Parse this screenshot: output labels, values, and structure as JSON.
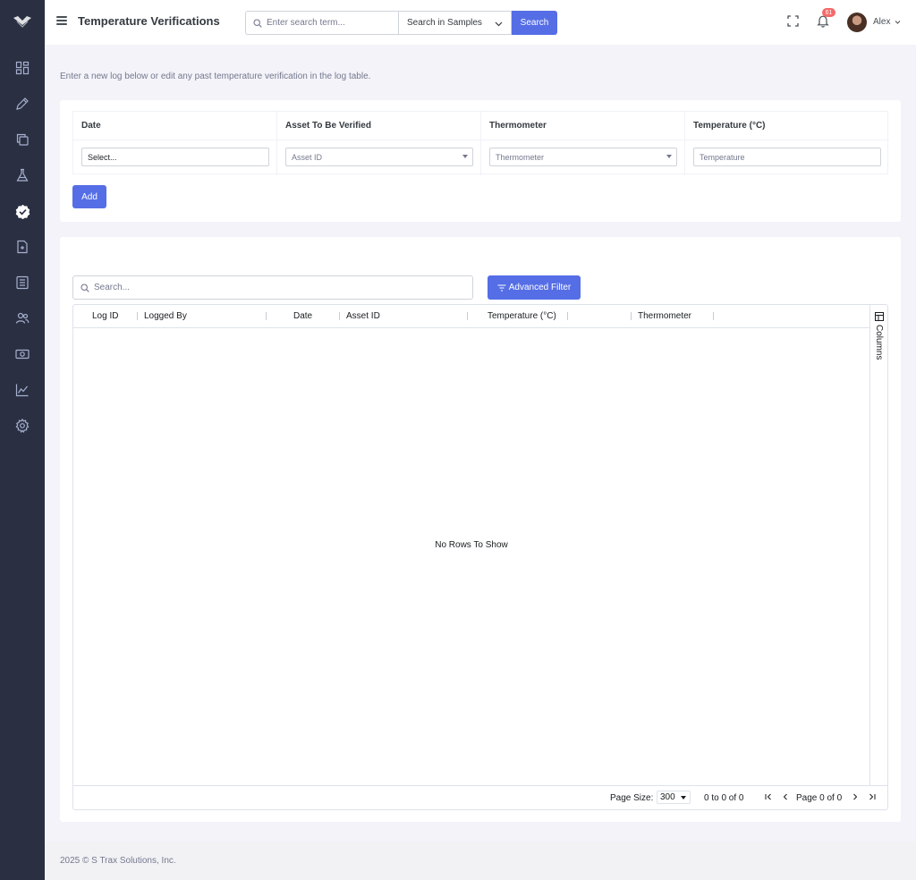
{
  "header": {
    "title": "Temperature Verifications",
    "search_placeholder": "Enter search term...",
    "search_scope": "Search in Samples",
    "search_button": "Search",
    "notification_count": "61",
    "user_name": "Alex"
  },
  "sidebar": {
    "items": [
      {
        "icon": "dashboard-icon"
      },
      {
        "icon": "pencil-icon"
      },
      {
        "icon": "copy-icon"
      },
      {
        "icon": "flask-icon"
      },
      {
        "icon": "check-badge-icon",
        "active": true
      },
      {
        "icon": "document-icon"
      },
      {
        "icon": "list-icon"
      },
      {
        "icon": "users-icon"
      },
      {
        "icon": "money-icon"
      },
      {
        "icon": "chart-icon"
      },
      {
        "icon": "gear-icon"
      }
    ]
  },
  "intro": "Enter a new log below or edit any past temperature verification in the log table.",
  "form": {
    "headers": [
      "Date",
      "Asset To Be Verified",
      "Thermometer",
      "Temperature (°C)"
    ],
    "date_value": "Select...",
    "asset_placeholder": "Asset ID",
    "thermometer_placeholder": "Thermometer",
    "temperature_placeholder": "Temperature",
    "add_button": "Add"
  },
  "grid": {
    "search_placeholder": "Search...",
    "advanced_filter": "Advanced Filter",
    "columns": [
      "Log ID",
      "Logged By",
      "Date",
      "Asset ID",
      "Temperature (°C)",
      "Thermometer"
    ],
    "side_panel_label": "Columns",
    "empty_message": "No Rows To Show",
    "page_size_label": "Page Size:",
    "page_size": "300",
    "range_text": "0 to 0 of 0",
    "page_text": "Page 0 of 0"
  },
  "colors": {
    "accent": "#556ee6",
    "sidebar_bg": "#2a3042",
    "badge": "#f46a6a"
  },
  "footer": "2025 © S Trax Solutions, Inc."
}
